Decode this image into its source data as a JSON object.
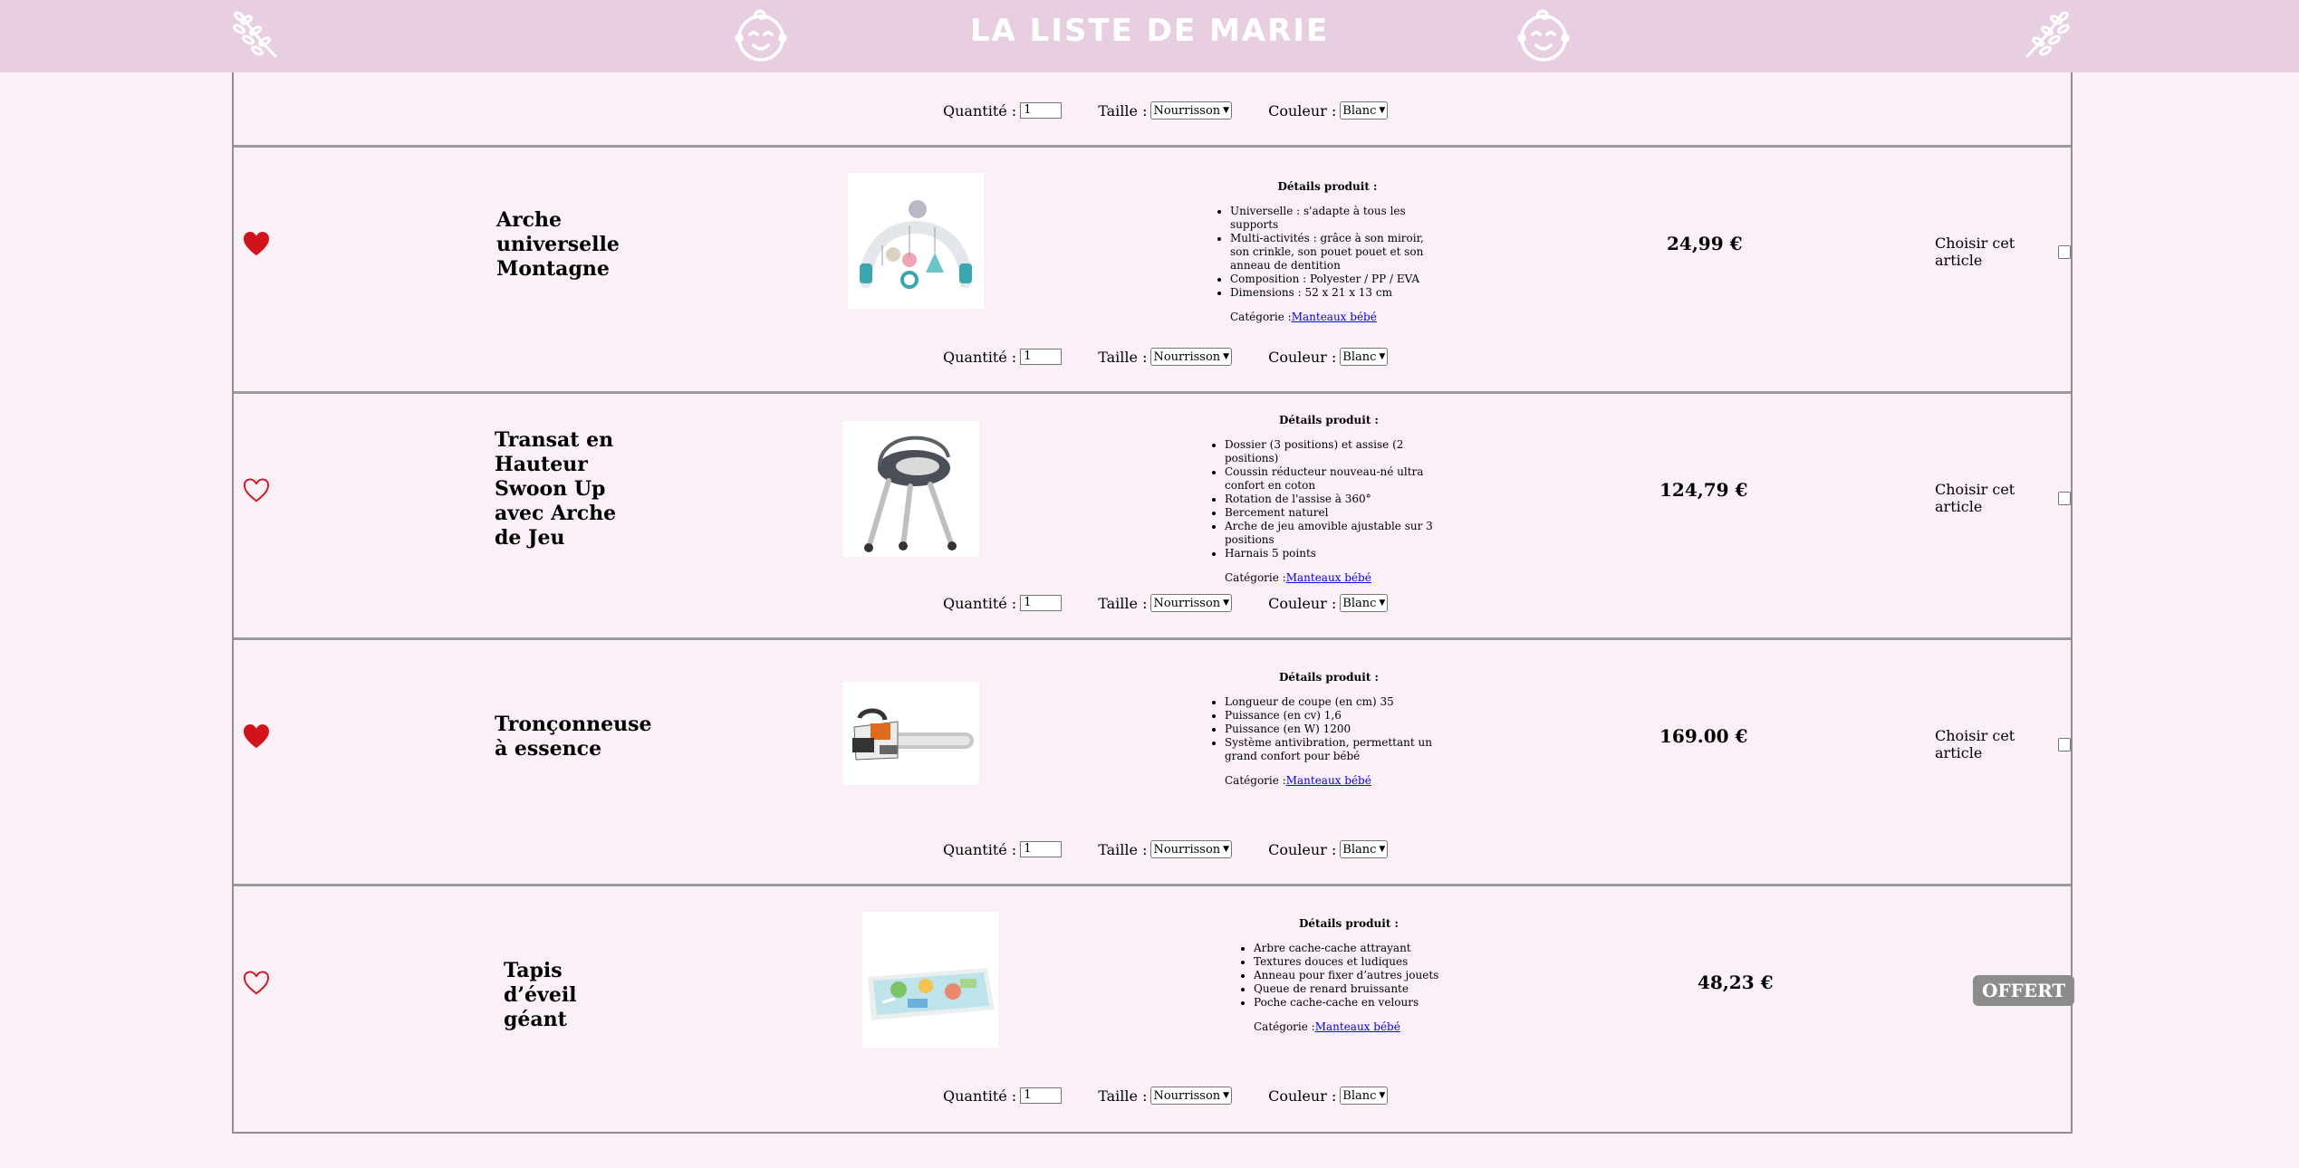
{
  "header": {
    "title": "LA LISTE DE MARIE"
  },
  "labels": {
    "quantity": "Quantité :",
    "size": "Taille :",
    "color": "Couleur :",
    "details_title": "Détails produit :",
    "category": "Catégorie :",
    "choose": "Choisir cet article"
  },
  "options_defaults": {
    "quantity": "1",
    "size": "Nourrisson",
    "color": "Blanc"
  },
  "top_partial_row": {
    "quantity": "1",
    "size": "Nourrisson",
    "color": "Blanc"
  },
  "products": [
    {
      "name": "Arche universelle Montagne",
      "favorite": true,
      "details": [
        "Universelle : s'adapte à tous les supports",
        "Multi-activités : grâce à son miroir, son crinkle, son pouet pouet et son anneau de dentition",
        "Composition : Polyester / PP / EVA",
        "Dimensions : 52 x 21 x 13 cm"
      ],
      "category_link": "Manteaux bébé",
      "price": "24,99 €",
      "status": "choose",
      "quantity": "1",
      "size": "Nourrisson",
      "color": "Blanc"
    },
    {
      "name": "Transat en Hauteur Swoon Up avec Arche de Jeu",
      "favorite": false,
      "details": [
        "Dossier (3 positions) et assise (2 positions)",
        "Coussin réducteur nouveau-né ultra confort en coton",
        "Rotation de l'assise à 360°",
        "Bercement naturel",
        "Arche de jeu amovible ajustable sur 3 positions",
        "Harnais 5 points"
      ],
      "category_link": "Manteaux bébé",
      "price": "124,79 €",
      "status": "choose",
      "quantity": "1",
      "size": "Nourrisson",
      "color": "Blanc"
    },
    {
      "name": "Tronçonneuse à essence",
      "favorite": true,
      "details": [
        "Longueur de coupe (en cm) 35",
        "Puissance (en cv) 1,6",
        "Puissance (en W) 1200",
        "Système antivibration, permettant un grand confort pour bébé"
      ],
      "category_link": "Manteaux bébé",
      "price": "169.00 €",
      "status": "choose",
      "quantity": "1",
      "size": "Nourrisson",
      "color": "Blanc"
    },
    {
      "name": "Tapis d’éveil géant",
      "favorite": false,
      "details": [
        "Arbre cache-cache attrayant",
        "Textures douces et ludiques",
        "Anneau pour fixer d’autres jouets",
        "Queue de renard bruissante",
        "Poche cache-cache en velours"
      ],
      "category_link": "Manteaux bébé",
      "price": "48,23 €",
      "status": "offered",
      "offered_label": "OFFERT",
      "quantity": "1",
      "size": "Nourrisson",
      "color": "Blanc"
    }
  ],
  "colors": {
    "header_bg": "#e7cfe1",
    "page_bg": "#fbf0f7",
    "heart": "#d0141a",
    "offert_bg": "#8c8c8c"
  }
}
